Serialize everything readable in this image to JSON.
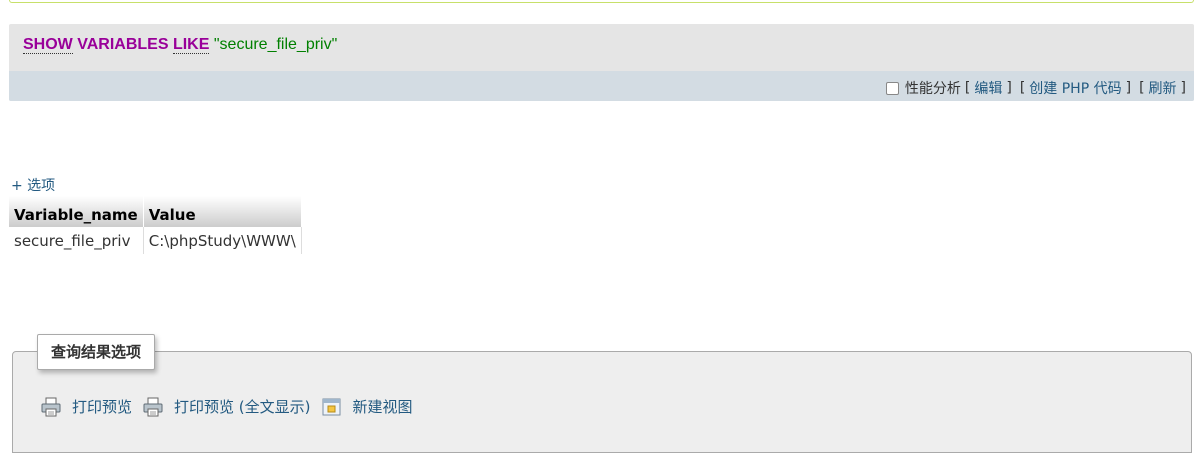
{
  "sql": {
    "keyword_show": "SHOW",
    "keyword_variables": "VARIABLES",
    "keyword_like": "LIKE",
    "string_literal": "\"secure_file_priv\""
  },
  "toolbar": {
    "profiling_label": "性能分析",
    "edit_label": "编辑",
    "create_php_label": "创建 PHP 代码",
    "refresh_label": "刷新",
    "bracket_open": "[",
    "bracket_close": "]"
  },
  "options_toggle": "+ 选项",
  "table": {
    "headers": [
      "Variable_name",
      "Value"
    ],
    "rows": [
      [
        "secure_file_priv",
        "C:\\phpStudy\\WWW\\"
      ]
    ]
  },
  "query_results": {
    "legend": "查询结果选项",
    "print_label": "打印预览",
    "print_full_label": "打印预览 (全文显示)",
    "create_view_label": "新建视图"
  },
  "icons": {
    "printer": "printer-icon",
    "view": "view-icon"
  },
  "colors": {
    "link": "#235a81",
    "sql_keyword": "#990099",
    "sql_string": "#008000",
    "sql_box_bg": "#e5e5e5",
    "toolbar_bg": "#d3dce3"
  }
}
